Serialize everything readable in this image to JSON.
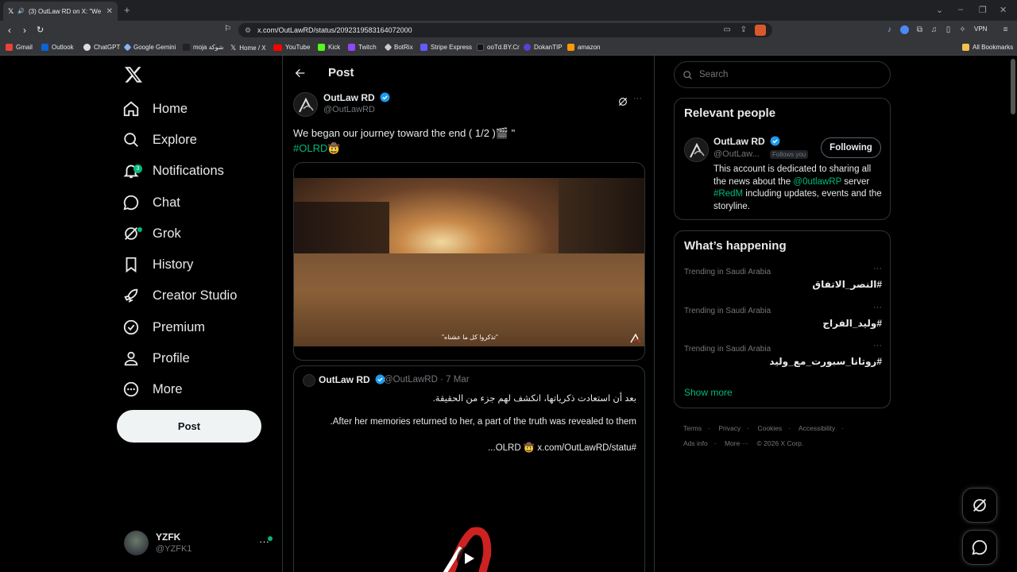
{
  "browser": {
    "tab_title": "(3) OutLaw RD on X: \"We be",
    "url": "x.com/OutLawRD/status/2092319583164072000",
    "vpn_label": "VPN",
    "bookmarks": [
      {
        "label": "Gmail",
        "color": "#ea4335"
      },
      {
        "label": "Outlook",
        "color": "#0a64d8"
      },
      {
        "label": "ChatGPT",
        "color": "#dddddd"
      },
      {
        "label": "Google Gemini",
        "color": "#8ab4f8"
      },
      {
        "label": "moja شوكة",
        "color": "#222222"
      },
      {
        "label": "Home / X",
        "color": "#000000"
      },
      {
        "label": "YouTube",
        "color": "#ff0000"
      },
      {
        "label": "Kick",
        "color": "#53fc18"
      },
      {
        "label": "Twitch",
        "color": "#9146ff"
      },
      {
        "label": "BotRix",
        "color": "#cccccc"
      },
      {
        "label": "Stripe Express",
        "color": "#635bff"
      },
      {
        "label": "ooTd.BY.Cr",
        "color": "#111111"
      },
      {
        "label": "DokanTIP",
        "color": "#5d3fd3"
      },
      {
        "label": "amazon",
        "color": "#ff9900"
      }
    ],
    "all_bookmarks": "All Bookmarks"
  },
  "nav": {
    "items": [
      {
        "label": "Home",
        "icon": "home-icon"
      },
      {
        "label": "Explore",
        "icon": "search-icon"
      },
      {
        "label": "Notifications",
        "icon": "bell-icon",
        "badge": "3"
      },
      {
        "label": "Chat",
        "icon": "chat-icon"
      },
      {
        "label": "Grok",
        "icon": "grok-icon"
      },
      {
        "label": "History",
        "icon": "bookmark-icon"
      },
      {
        "label": "Creator Studio",
        "icon": "rocket-icon"
      },
      {
        "label": "Premium",
        "icon": "verified-icon"
      },
      {
        "label": "Profile",
        "icon": "person-icon"
      },
      {
        "label": "More",
        "icon": "more-circle-icon"
      }
    ],
    "post_button": "Post",
    "user": {
      "name": "YZFK",
      "handle": "@YZFK1"
    }
  },
  "post": {
    "header_title": "Post",
    "author_name": "OutLaw RD",
    "author_handle": "@OutLawRD",
    "text": "We began our journey toward the end ( 1/2 )🎬 \"",
    "hashtag": "#OLRD🤠",
    "video_caption": "\"تذكروا كل ما عشناه\"",
    "quote": {
      "author_name": "OutLaw RD",
      "meta": "@OutLawRD · 7 Mar",
      "line1": "بعد أن استعادت ذكرياتها، انكشف لهم جزء من الحقيقة.",
      "line2": "After her memories returned to her, a part of the truth was revealed to them.",
      "line3": "#OLRD 🤠 x.com/OutLawRD/statu..."
    }
  },
  "sidebar": {
    "search_placeholder": "Search",
    "relevant_title": "Relevant people",
    "person": {
      "name": "OutLaw RD",
      "handle": "@OutLaw...",
      "follows_you": "Follows you",
      "follow_label": "Following",
      "bio_1": "This account is dedicated to sharing all the news about the ",
      "bio_mention": "@0utlawRP",
      "bio_2": " server ",
      "bio_tag": "#RedM",
      "bio_3": " including updates, events and the storyline."
    },
    "happening_title": "What’s happening",
    "trends": [
      {
        "context": "Trending in Saudi Arabia",
        "title": "#النصر_الاتفاق"
      },
      {
        "context": "Trending in Saudi Arabia",
        "title": "#وليد_الفراج"
      },
      {
        "context": "Trending in Saudi Arabia",
        "title": "#روتانا_سبورت_مع_وليد"
      }
    ],
    "show_more": "Show more",
    "footer": {
      "terms": "Terms",
      "privacy": "Privacy",
      "cookies": "Cookies",
      "accessibility": "Accessibility",
      "ads_info": "Ads info",
      "more": "More ···",
      "copyright": "© 2026 X Corp."
    }
  },
  "colors": {
    "accent": "#00ba7c",
    "verified": "#1d9bf0",
    "muted": "#71767b",
    "border": "#2f3336"
  }
}
